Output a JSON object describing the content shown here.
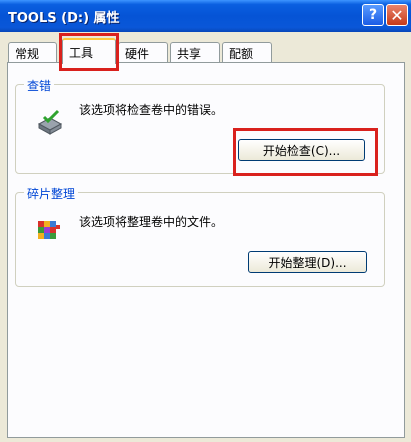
{
  "window": {
    "title": "TOOLS (D:) 属性",
    "help_label": "?",
    "close_label": "✕"
  },
  "tabs": [
    {
      "label": "常规",
      "active": false
    },
    {
      "label": "工具",
      "active": true
    },
    {
      "label": "硬件",
      "active": false
    },
    {
      "label": "共享",
      "active": false
    },
    {
      "label": "配额",
      "active": false
    }
  ],
  "error_check": {
    "group_label": "查错",
    "description": "该选项将检查卷中的错误。",
    "button_label": "开始检查(C)...",
    "icon": "disk-check-icon"
  },
  "defrag": {
    "group_label": "碎片整理",
    "description": "该选项将整理卷中的文件。",
    "button_label": "开始整理(D)...",
    "icon": "defrag-icon"
  },
  "colors": {
    "title_bar": "#0554d6",
    "group_label": "#0046d5",
    "highlight": "#d9211d"
  }
}
